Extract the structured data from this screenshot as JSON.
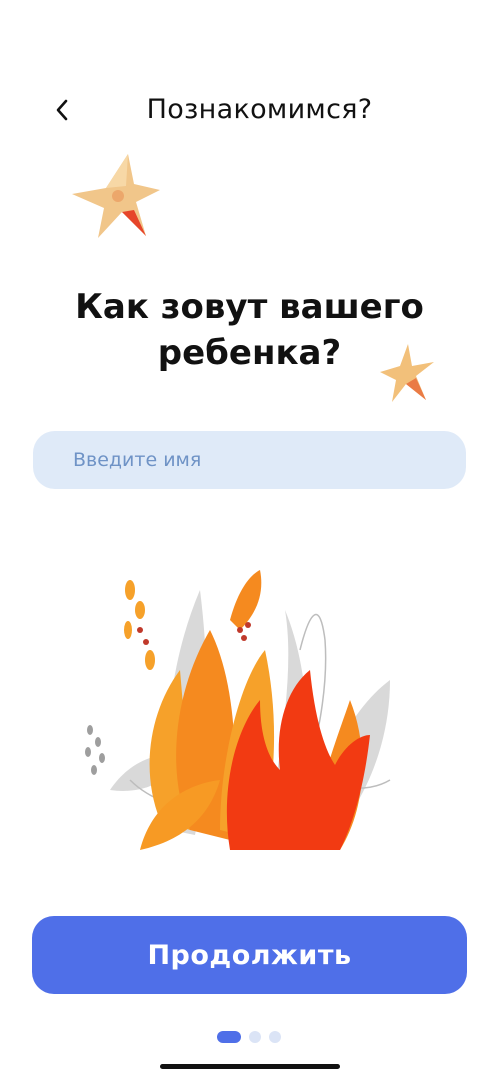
{
  "header": {
    "back_icon": "chevron-left-icon",
    "title": "Познакомимся?"
  },
  "question": "Как зовут вашего ребенка?",
  "name_input": {
    "placeholder": "Введите имя",
    "value": ""
  },
  "continue_label": "Продолжить",
  "pagination": {
    "total": 3,
    "current": 1
  },
  "colors": {
    "accent": "#4f6fe8",
    "input_bg": "#dfeaf8",
    "placeholder": "#6f93c6",
    "flame_orange": "#f5891e",
    "flame_red": "#f23a12"
  }
}
